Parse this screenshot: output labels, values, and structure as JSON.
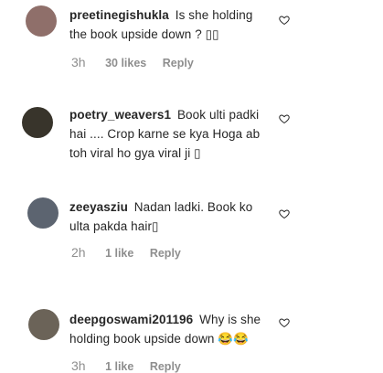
{
  "comments": [
    {
      "username": "preetinegishukla",
      "text": "Is she holding the book upside down ? ▯▯",
      "time": "3h",
      "likes": "30 likes",
      "reply": "Reply"
    },
    {
      "username": "poetry_weavers1",
      "text": "Book ulti padki hai .... Crop karne se kya Hoga ab toh viral ho gya viral ji ▯",
      "time": "",
      "likes": "",
      "reply": ""
    },
    {
      "username": "zeeyasziu",
      "text": "Nadan ladki. Book ko ulta pakda hair▯",
      "time": "2h",
      "likes": "1 like",
      "reply": "Reply"
    },
    {
      "username": "deepgoswami201196",
      "text": "Why is she holding book upside down 😂😂",
      "time": "3h",
      "likes": "1 like",
      "reply": "Reply"
    }
  ],
  "icons": {
    "heart": "heart-outline-icon",
    "avatar": "user-avatar"
  },
  "colors": {
    "text": "#262626",
    "meta": "#8e8e8e",
    "background": "#ffffff"
  }
}
